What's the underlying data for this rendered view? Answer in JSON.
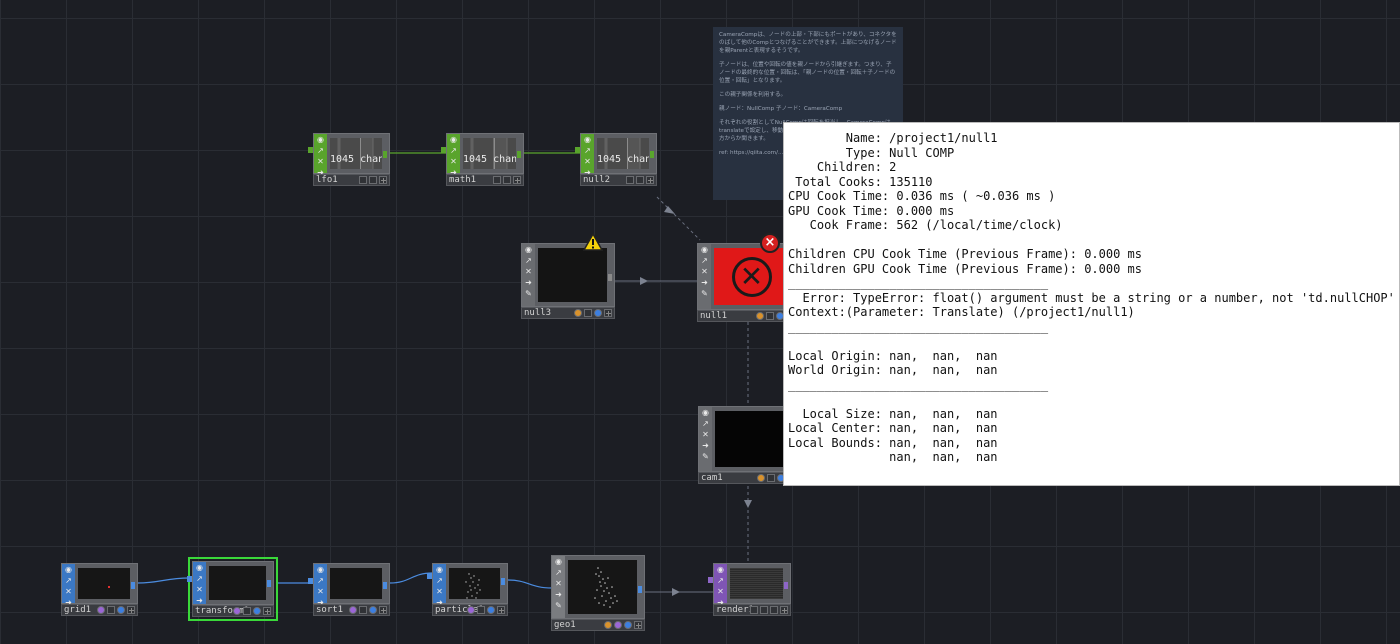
{
  "note": {
    "lines": [
      "CameraCompは、ノードの上部・下部にもポートがあり、コネクタをのばして他のCompとつなげることができます。上部につなげるノードを親Parentと表現するそうです。",
      "子ノードは、位置や回転の値を親ノードから引継ぎます。つまり、子ノードの最終的な位置・回転は、「親ノードの位置・回転＋子ノードの位置・回転」となります。",
      "この親子関係を利用する。",
      "親ノード：NullComp 子ノード：CameraComp",
      "それぞれの役割としてNullCompは回転を担当し、CameraCompはtranslateで設定し、移動・回転の設定ができるようにしました。使い方からか聞きます。",
      "ref: https://qiita.com/... 64ec7f5927d36f702fe..."
    ]
  },
  "nodes": {
    "lfo1": {
      "label": "lfo1",
      "viewer": "1045 chan"
    },
    "math1": {
      "label": "math1",
      "viewer": "1045 chan"
    },
    "null2": {
      "label": "null2",
      "viewer": "1045 chan"
    },
    "null3": {
      "label": "null3"
    },
    "null1": {
      "label": "null1"
    },
    "cam1": {
      "label": "cam1"
    },
    "grid1": {
      "label": "grid1"
    },
    "transform1": {
      "label": "transform1"
    },
    "sort1": {
      "label": "sort1"
    },
    "particle1": {
      "label": "particle1"
    },
    "geo1": {
      "label": "geo1"
    },
    "render1": {
      "label": "render1"
    }
  },
  "info": {
    "lines": [
      "        Name: /project1/null1",
      "        Type: Null COMP",
      "    Children: 2",
      " Total Cooks: 135110",
      "CPU Cook Time: 0.036 ms ( ~0.036 ms )",
      "GPU Cook Time: 0.000 ms",
      "   Cook Frame: 562 (/local/time/clock)",
      "",
      "Children CPU Cook Time (Previous Frame): 0.000 ms",
      "Children GPU Cook Time (Previous Frame): 0.000 ms",
      "____________________________________",
      "  Error: TypeError: float() argument must be a string or a number, not 'td.nullCHOP'",
      "Context:(Parameter: Translate) (/project1/null1)",
      "____________________________________",
      "",
      "Local Origin: nan,  nan,  nan",
      "World Origin: nan,  nan,  nan",
      "____________________________________",
      "",
      "  Local Size: nan,  nan,  nan",
      "Local Center: nan,  nan,  nan",
      "Local Bounds: nan,  nan,  nan",
      "              nan,  nan,  nan"
    ]
  },
  "colors": {
    "chop": "#59a42c",
    "top": "#3b78c4",
    "material": "#7f55b5",
    "error": "#e01818",
    "selection": "#3ad83a"
  }
}
